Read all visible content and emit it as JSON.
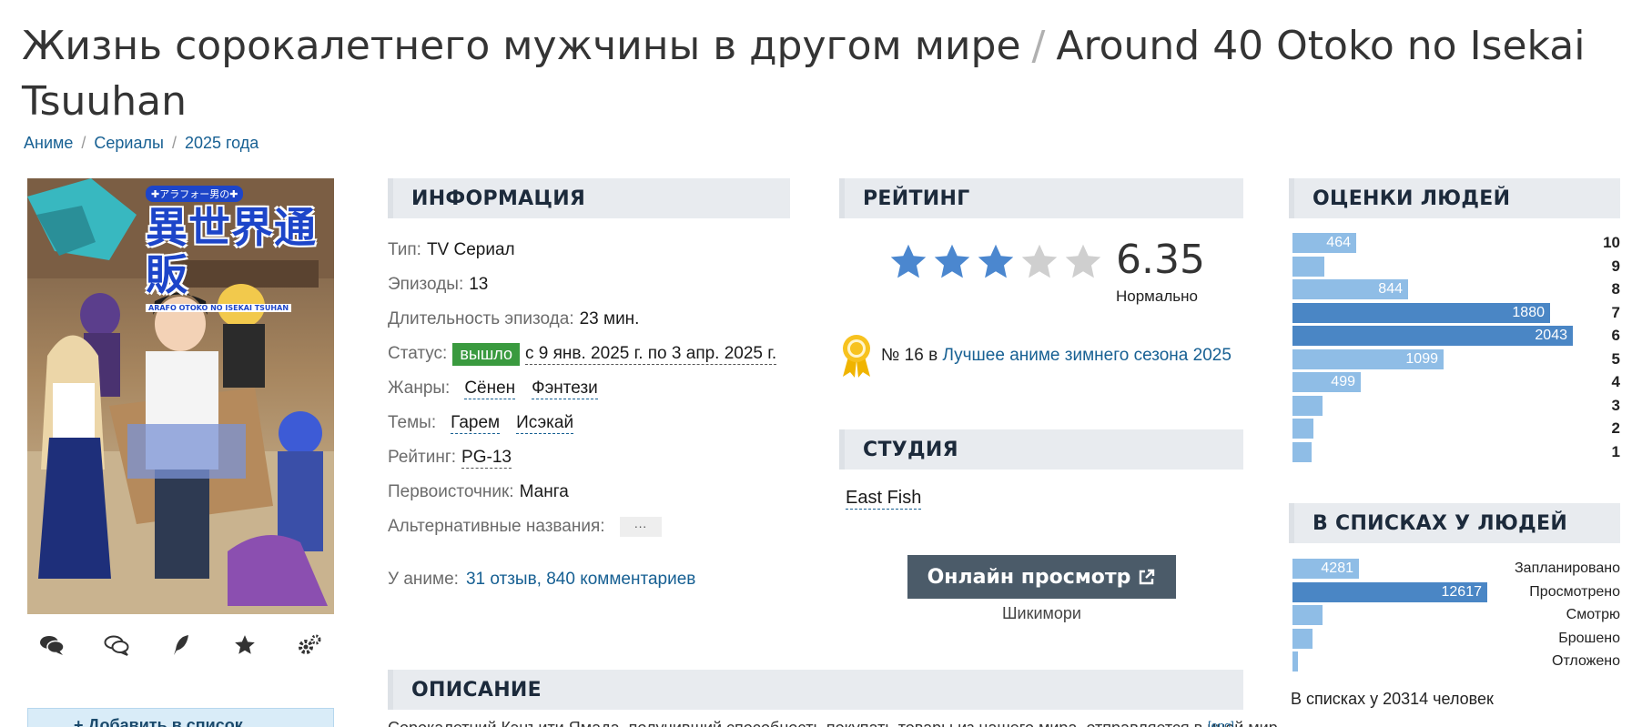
{
  "title": {
    "ru": "Жизнь сорокалетнего мужчины в другом мире",
    "separator": "/",
    "original": "Around 40 Otoko no Isekai Tsuuhan"
  },
  "breadcrumbs": [
    "Аниме",
    "Сериалы",
    "2025 года"
  ],
  "poster": {
    "logo_top": "✚アラフォー男の✚",
    "logo_main": "異世界通販",
    "logo_sub": "ARAFO OTOKO NO ISEKAI TSUHAN"
  },
  "poster_actions": [
    "comments-icon",
    "discussion-icon",
    "review-icon",
    "favorite-star-icon",
    "settings-gear-icon"
  ],
  "add_list_label": "+ Добавить в список",
  "sections": {
    "info": "ИНФОРМАЦИЯ",
    "rating": "РЕЙТИНГ",
    "studio": "СТУДИЯ",
    "scores": "ОЦЕНКИ ЛЮДЕЙ",
    "lists": "В СПИСКАХ У ЛЮДЕЙ",
    "description": "ОПИСАНИЕ"
  },
  "info": {
    "type_label": "Тип:",
    "type_value": "TV Сериал",
    "episodes_label": "Эпизоды:",
    "episodes_value": "13",
    "duration_label": "Длительность эпизода:",
    "duration_value": "23 мин.",
    "status_label": "Статус:",
    "status_badge": "вышло",
    "status_value": "с 9 янв. 2025 г. по 3 апр. 2025 г.",
    "genres_label": "Жанры:",
    "genres": [
      "Сёнен",
      "Фэнтези"
    ],
    "themes_label": "Темы:",
    "themes": [
      "Гарем",
      "Исэкай"
    ],
    "rating_label": "Рейтинг:",
    "rating_value": "PG-13",
    "source_label": "Первоисточник:",
    "source_value": "Манга",
    "alt_label": "Альтернативные названия:",
    "alt_button": "···"
  },
  "reviews": {
    "label": "У аниме:",
    "reviews_link": "31 отзыв",
    "comments_link": "840 комментариев"
  },
  "rating": {
    "score": "6.35",
    "score_value": 6.35,
    "stars_filled": 3,
    "stars_total": 5,
    "word": "Нормально",
    "star_color": "#4b87cf",
    "star_empty_color": "#cfcfcf"
  },
  "award": {
    "prefix": "№ 16 в",
    "link": "Лучшее аниме зимнего сезона 2025"
  },
  "studio": {
    "name": "East Fish"
  },
  "watch": {
    "label": "Онлайн просмотр",
    "source": "Шикимори"
  },
  "scores_dist": {
    "max": 2043,
    "items": [
      {
        "label": "10",
        "value": 464,
        "show": "464"
      },
      {
        "label": "9",
        "value": 230,
        "show": ""
      },
      {
        "label": "8",
        "value": 844,
        "show": "844"
      },
      {
        "label": "7",
        "value": 1880,
        "show": "1880"
      },
      {
        "label": "6",
        "value": 2043,
        "show": "2043"
      },
      {
        "label": "5",
        "value": 1099,
        "show": "1099"
      },
      {
        "label": "4",
        "value": 499,
        "show": "499"
      },
      {
        "label": "3",
        "value": 220,
        "show": ""
      },
      {
        "label": "2",
        "value": 150,
        "show": ""
      },
      {
        "label": "1",
        "value": 140,
        "show": ""
      }
    ]
  },
  "lists_dist": {
    "max": 12617,
    "total_text": "В списках у 20314 человек",
    "items": [
      {
        "label": "Запланировано",
        "value": 4281,
        "show": "4281"
      },
      {
        "label": "Просмотрено",
        "value": 12617,
        "show": "12617"
      },
      {
        "label": "Смотрю",
        "value": 1950,
        "show": ""
      },
      {
        "label": "Брошено",
        "value": 1300,
        "show": ""
      },
      {
        "label": "Отложено",
        "value": 166,
        "show": ""
      }
    ]
  },
  "description": {
    "text": "Сорокалетний Кэнъити Ямада, получивший способность покупать товары из нашего мира, отправляется в иной мир...",
    "eng_link": "[eng]"
  },
  "colors": {
    "link": "#176093",
    "bar_light": "#8fbde6",
    "bar_dark": "#4a86c5",
    "section_bg": "#e8ebef",
    "badge_green": "#3a9a3f",
    "button_dark": "#4b5b69"
  }
}
